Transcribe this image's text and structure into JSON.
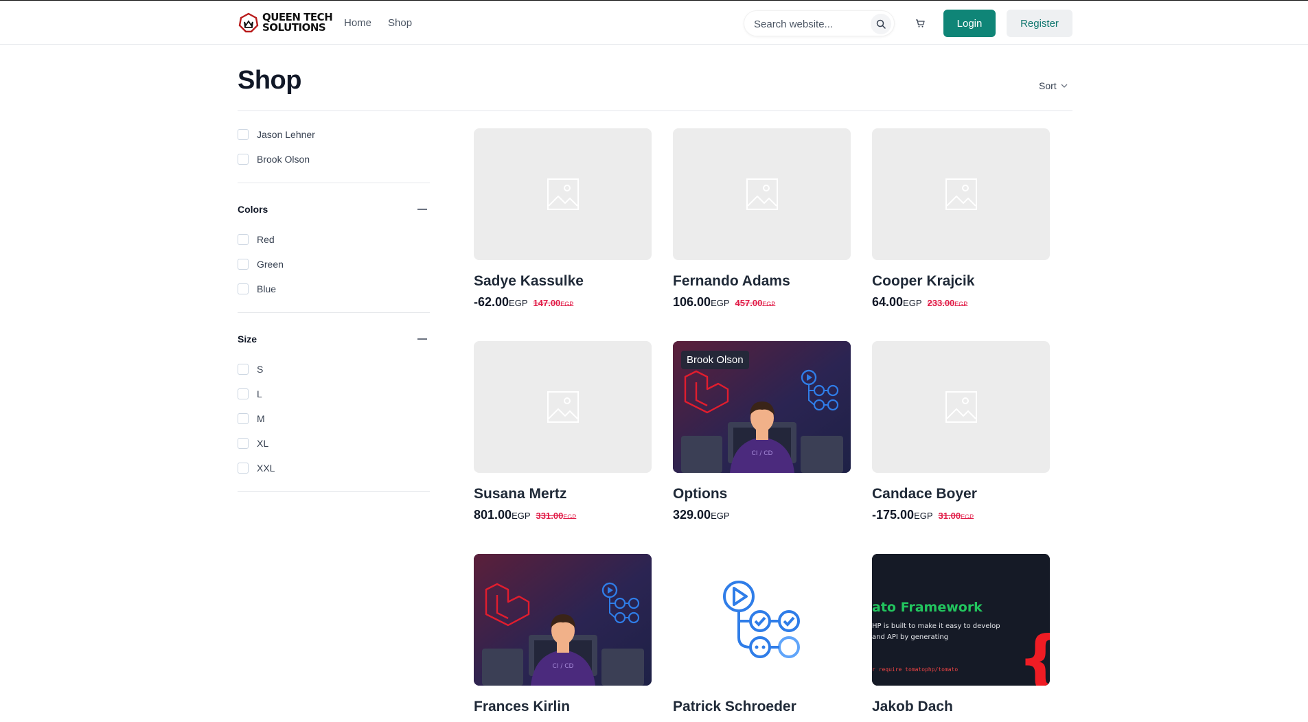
{
  "brand": {
    "line1": "QUEEN TECH",
    "line2": "SOLUTIONS"
  },
  "nav": [
    {
      "label": "Home"
    },
    {
      "label": "Shop"
    }
  ],
  "search": {
    "placeholder": "Search website..."
  },
  "auth": {
    "login": "Login",
    "register": "Register"
  },
  "page": {
    "title": "Shop",
    "sort_label": "Sort"
  },
  "filters": {
    "vendors": [
      "Jason Lehner",
      "Brook Olson"
    ],
    "colors": {
      "title": "Colors",
      "options": [
        "Red",
        "Green",
        "Blue"
      ]
    },
    "size": {
      "title": "Size",
      "options": [
        "S",
        "L",
        "M",
        "XL",
        "XXL"
      ]
    }
  },
  "products": [
    {
      "name": "Sadye Kassulke",
      "price": "-62.00",
      "currency": "EGP",
      "old_price": "147.00",
      "image": "placeholder-image-icon"
    },
    {
      "name": "Fernando Adams",
      "price": "106.00",
      "currency": "EGP",
      "old_price": "457.00",
      "image": "placeholder-image-icon"
    },
    {
      "name": "Cooper Krajcik",
      "price": "64.00",
      "currency": "EGP",
      "old_price": "233.00",
      "image": "placeholder-image-icon"
    },
    {
      "name": "Susana Mertz",
      "price": "801.00",
      "currency": "EGP",
      "old_price": "331.00",
      "image": "placeholder-image-icon"
    },
    {
      "name": "Options",
      "price": "329.00",
      "currency": "EGP",
      "old_price": "",
      "badge": "Brook Olson",
      "image": "laravel-cicd-illustration",
      "shirt_text": "CI / CD"
    },
    {
      "name": "Candace Boyer",
      "price": "-175.00",
      "currency": "EGP",
      "old_price": "31.00",
      "image": "placeholder-image-icon"
    },
    {
      "name": "Frances Kirlin",
      "image": "laravel-cicd-illustration",
      "shirt_text": "CI / CD"
    },
    {
      "name": "Patrick Schroeder",
      "image": "github-actions-workflow-icon"
    },
    {
      "name": "Jakob Dach",
      "image": "framework-code-banner",
      "banner": {
        "heading": "ato Framework",
        "line1": "HP is built to make it easy to develop",
        "line2": "and API by generating",
        "cmd": "r require tomatophp/tomato"
      }
    }
  ],
  "colors": {
    "accent": "#0f8577",
    "sale": "#e11d48",
    "placeholder": "#ececec"
  }
}
